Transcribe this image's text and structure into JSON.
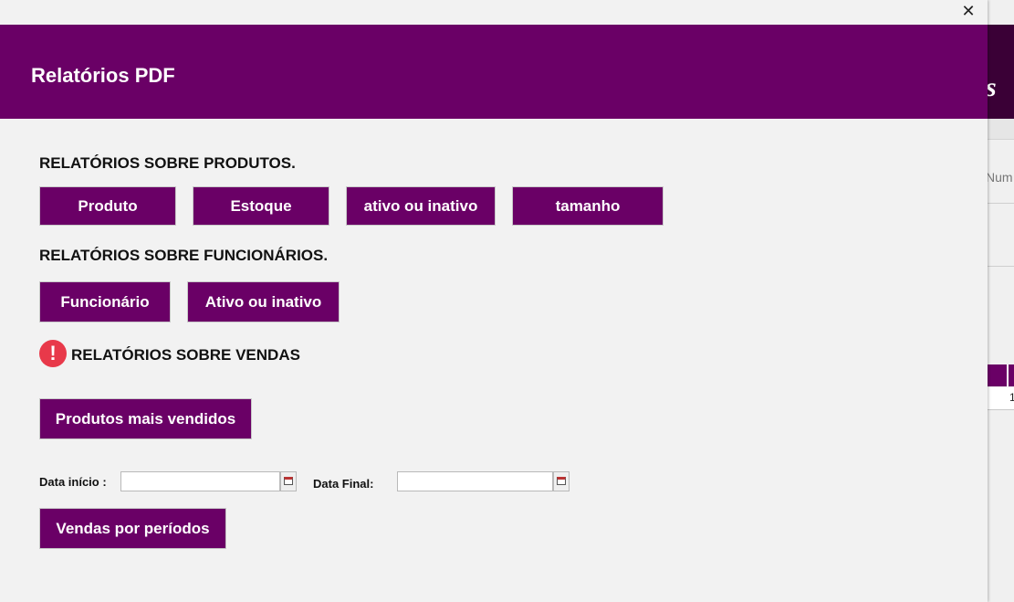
{
  "background": {
    "header_fragment": "s",
    "column_fragment": "Num",
    "row_fragment": "1"
  },
  "dialog": {
    "title": "Relatórios PDF",
    "close_glyph": "✕"
  },
  "products": {
    "section_title": "RELATÓRIOS SOBRE PRODUTOS.",
    "buttons": [
      "Produto",
      "Estoque",
      "ativo ou inativo",
      "tamanho"
    ]
  },
  "employees": {
    "section_title": "RELATÓRIOS SOBRE FUNCIONÁRIOS.",
    "buttons": [
      "Funcionário",
      "Ativo ou inativo"
    ]
  },
  "sales": {
    "section_title": "RELATÓRIOS SOBRE VENDAS",
    "alert_icon": "!",
    "best_sellers_button": "Produtos mais vendidos",
    "start_date_label": "Data início :",
    "start_date_value": "",
    "end_date_label": "Data Final:",
    "end_date_value": "",
    "by_period_button": "Vendas por períodos"
  },
  "colors": {
    "primary": "#6a0066",
    "alert": "#e8394a",
    "background": "#f2f2f2"
  },
  "icons": [
    "close-icon",
    "alert-icon",
    "calendar-icon"
  ]
}
